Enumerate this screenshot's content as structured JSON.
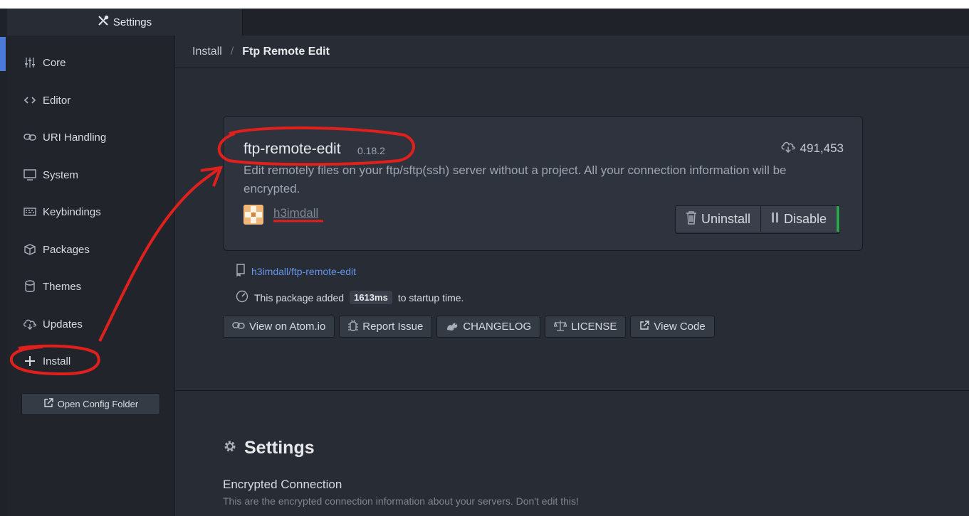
{
  "tab": {
    "title": "Settings",
    "icon": "tools-icon"
  },
  "sidebar": {
    "items": [
      {
        "label": "Core",
        "icon": "sliders-icon"
      },
      {
        "label": "Editor",
        "icon": "code-icon"
      },
      {
        "label": "URI Handling",
        "icon": "link-icon"
      },
      {
        "label": "System",
        "icon": "monitor-icon"
      },
      {
        "label": "Keybindings",
        "icon": "keyboard-icon"
      },
      {
        "label": "Packages",
        "icon": "package-icon"
      },
      {
        "label": "Themes",
        "icon": "paintcan-icon"
      },
      {
        "label": "Updates",
        "icon": "cloud-download-icon"
      },
      {
        "label": "Install",
        "icon": "plus-icon"
      }
    ],
    "open_config_label": "Open Config Folder"
  },
  "breadcrumb": {
    "parent": "Install",
    "separator": "/",
    "current": "Ftp Remote Edit"
  },
  "package": {
    "name": "ftp-remote-edit",
    "version": "0.18.2",
    "downloads": "491,453",
    "description": "Edit remotely files on your ftp/sftp(ssh) server without a project. All your connection information will be encrypted.",
    "author": "h3imdall",
    "uninstall_label": "Uninstall",
    "disable_label": "Disable",
    "repo": "h3imdall/ftp-remote-edit",
    "startup_prefix": "This package added",
    "startup_time": "1613ms",
    "startup_suffix": "to startup time."
  },
  "links": {
    "view_on_atom": "View on Atom.io",
    "report_issue": "Report Issue",
    "changelog": "CHANGELOG",
    "license": "LICENSE",
    "view_code": "View Code"
  },
  "settings": {
    "heading": "Settings",
    "setting_title": "Encrypted Connection",
    "setting_desc": "This are the encrypted connection information about your servers. Don't edit this!"
  },
  "colors": {
    "background": "#282c34",
    "sidebar": "#21252b",
    "accent_link": "#6494ed",
    "enabled_indicator": "#2da44e",
    "annotation": "#e0201c"
  }
}
